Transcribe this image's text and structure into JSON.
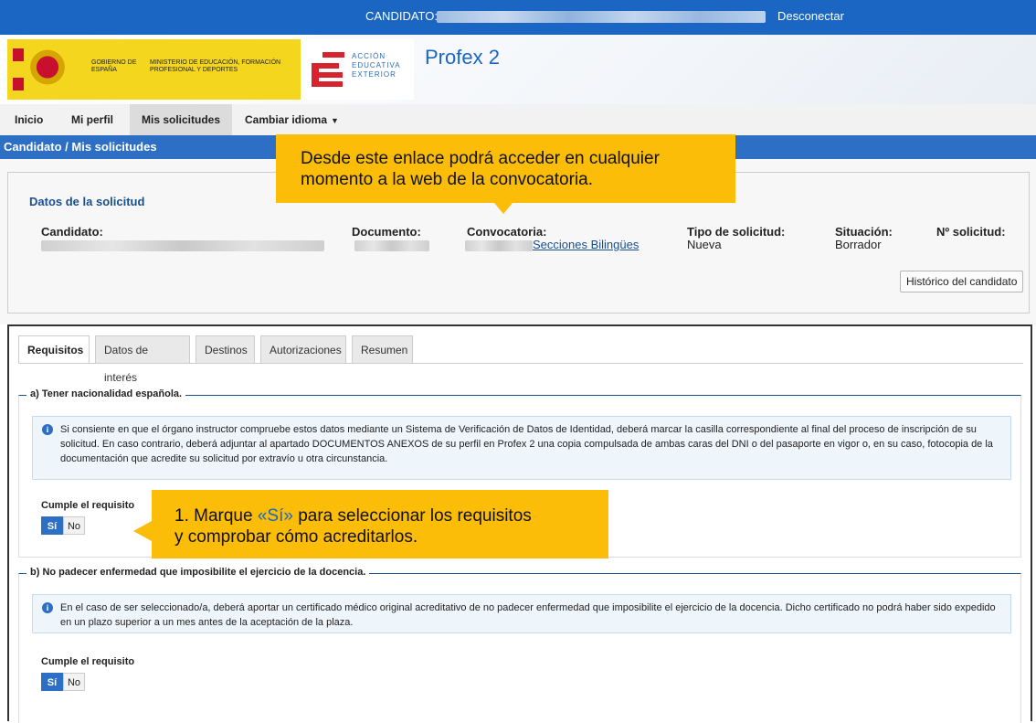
{
  "topbar": {
    "candidate_label": "CANDIDATO:",
    "logout": "Desconectar"
  },
  "header": {
    "gov_name": "GOBIERNO DE ESPAÑA",
    "ministry": "MINISTERIO DE EDUCACIÓN, FORMACIÓN PROFESIONAL Y DEPORTES",
    "aee": "ACCIÓN EDUCATIVA EXTERIOR",
    "app_title": "Profex 2"
  },
  "nav": {
    "home": "Inicio",
    "profile": "Mi perfil",
    "requests": "Mis solicitudes",
    "language": "Cambiar idioma"
  },
  "breadcrumb": "Candidato / Mis solicitudes",
  "request_data": {
    "title": "Datos de la solicitud",
    "candidate_h": "Candidato:",
    "document_h": "Documento:",
    "call_h": "Convocatoria:",
    "call_link": "Secciones Bilingües",
    "type_h": "Tipo de solicitud:",
    "type_v": "Nueva",
    "status_h": "Situación:",
    "status_v": "Borrador",
    "number_h": "Nº solicitud:",
    "history_button": "Histórico del candidato"
  },
  "callouts": {
    "top": [
      "Desde este enlace podrá acceder en cualquier",
      "momento a la web de la convocatoria."
    ],
    "bottom_prefix": "1. Marque ",
    "bottom_highlight": "«Sí»",
    "bottom_suffix": " para seleccionar los requisitos",
    "bottom_line2": "y comprobar cómo acreditarlos."
  },
  "tabs": [
    "Requisitos",
    "Datos de interés",
    "Destinos",
    "Autorizaciones",
    "Resumen"
  ],
  "requirements": [
    {
      "legend": "a) Tener nacionalidad española.",
      "info": "Si consiente en que el órgano instructor compruebe estos datos mediante un Sistema de Verificación de Datos de Identidad, deberá marcar la casilla correspondiente al final del proceso de inscripción de su solicitud. En caso contrario, deberá adjuntar al apartado DOCUMENTOS ANEXOS de su perfil en Profex 2 una copia compulsada de ambas caras del DNI o del pasaporte en vigor o, en su caso, fotocopia de la documentación que acredite su solicitud por extravío u otra circunstancia.",
      "label": "Cumple el requisito",
      "yes": "Sí",
      "no": "No"
    },
    {
      "legend": "b) No padecer enfermedad que imposibilite el ejercicio de la docencia.",
      "info": "En el caso de ser seleccionado/a, deberá aportar un certificado médico original acreditativo de no padecer enfermedad que imposibilite el ejercicio de la docencia. Dicho certificado no podrá haber sido expedido en un plazo superior a un mes antes de la aceptación de la plaza.",
      "label": "Cumple el requisito",
      "yes": "Sí",
      "no": "No"
    }
  ],
  "colors": {
    "topbar": "#1a66c2",
    "breadcrumb_bar": "#2d6fc4",
    "callout": "#fbbd08",
    "yes_active": "#2d6fc4"
  },
  "icons": {
    "info": "info-icon",
    "caret": "caret-down-icon"
  }
}
